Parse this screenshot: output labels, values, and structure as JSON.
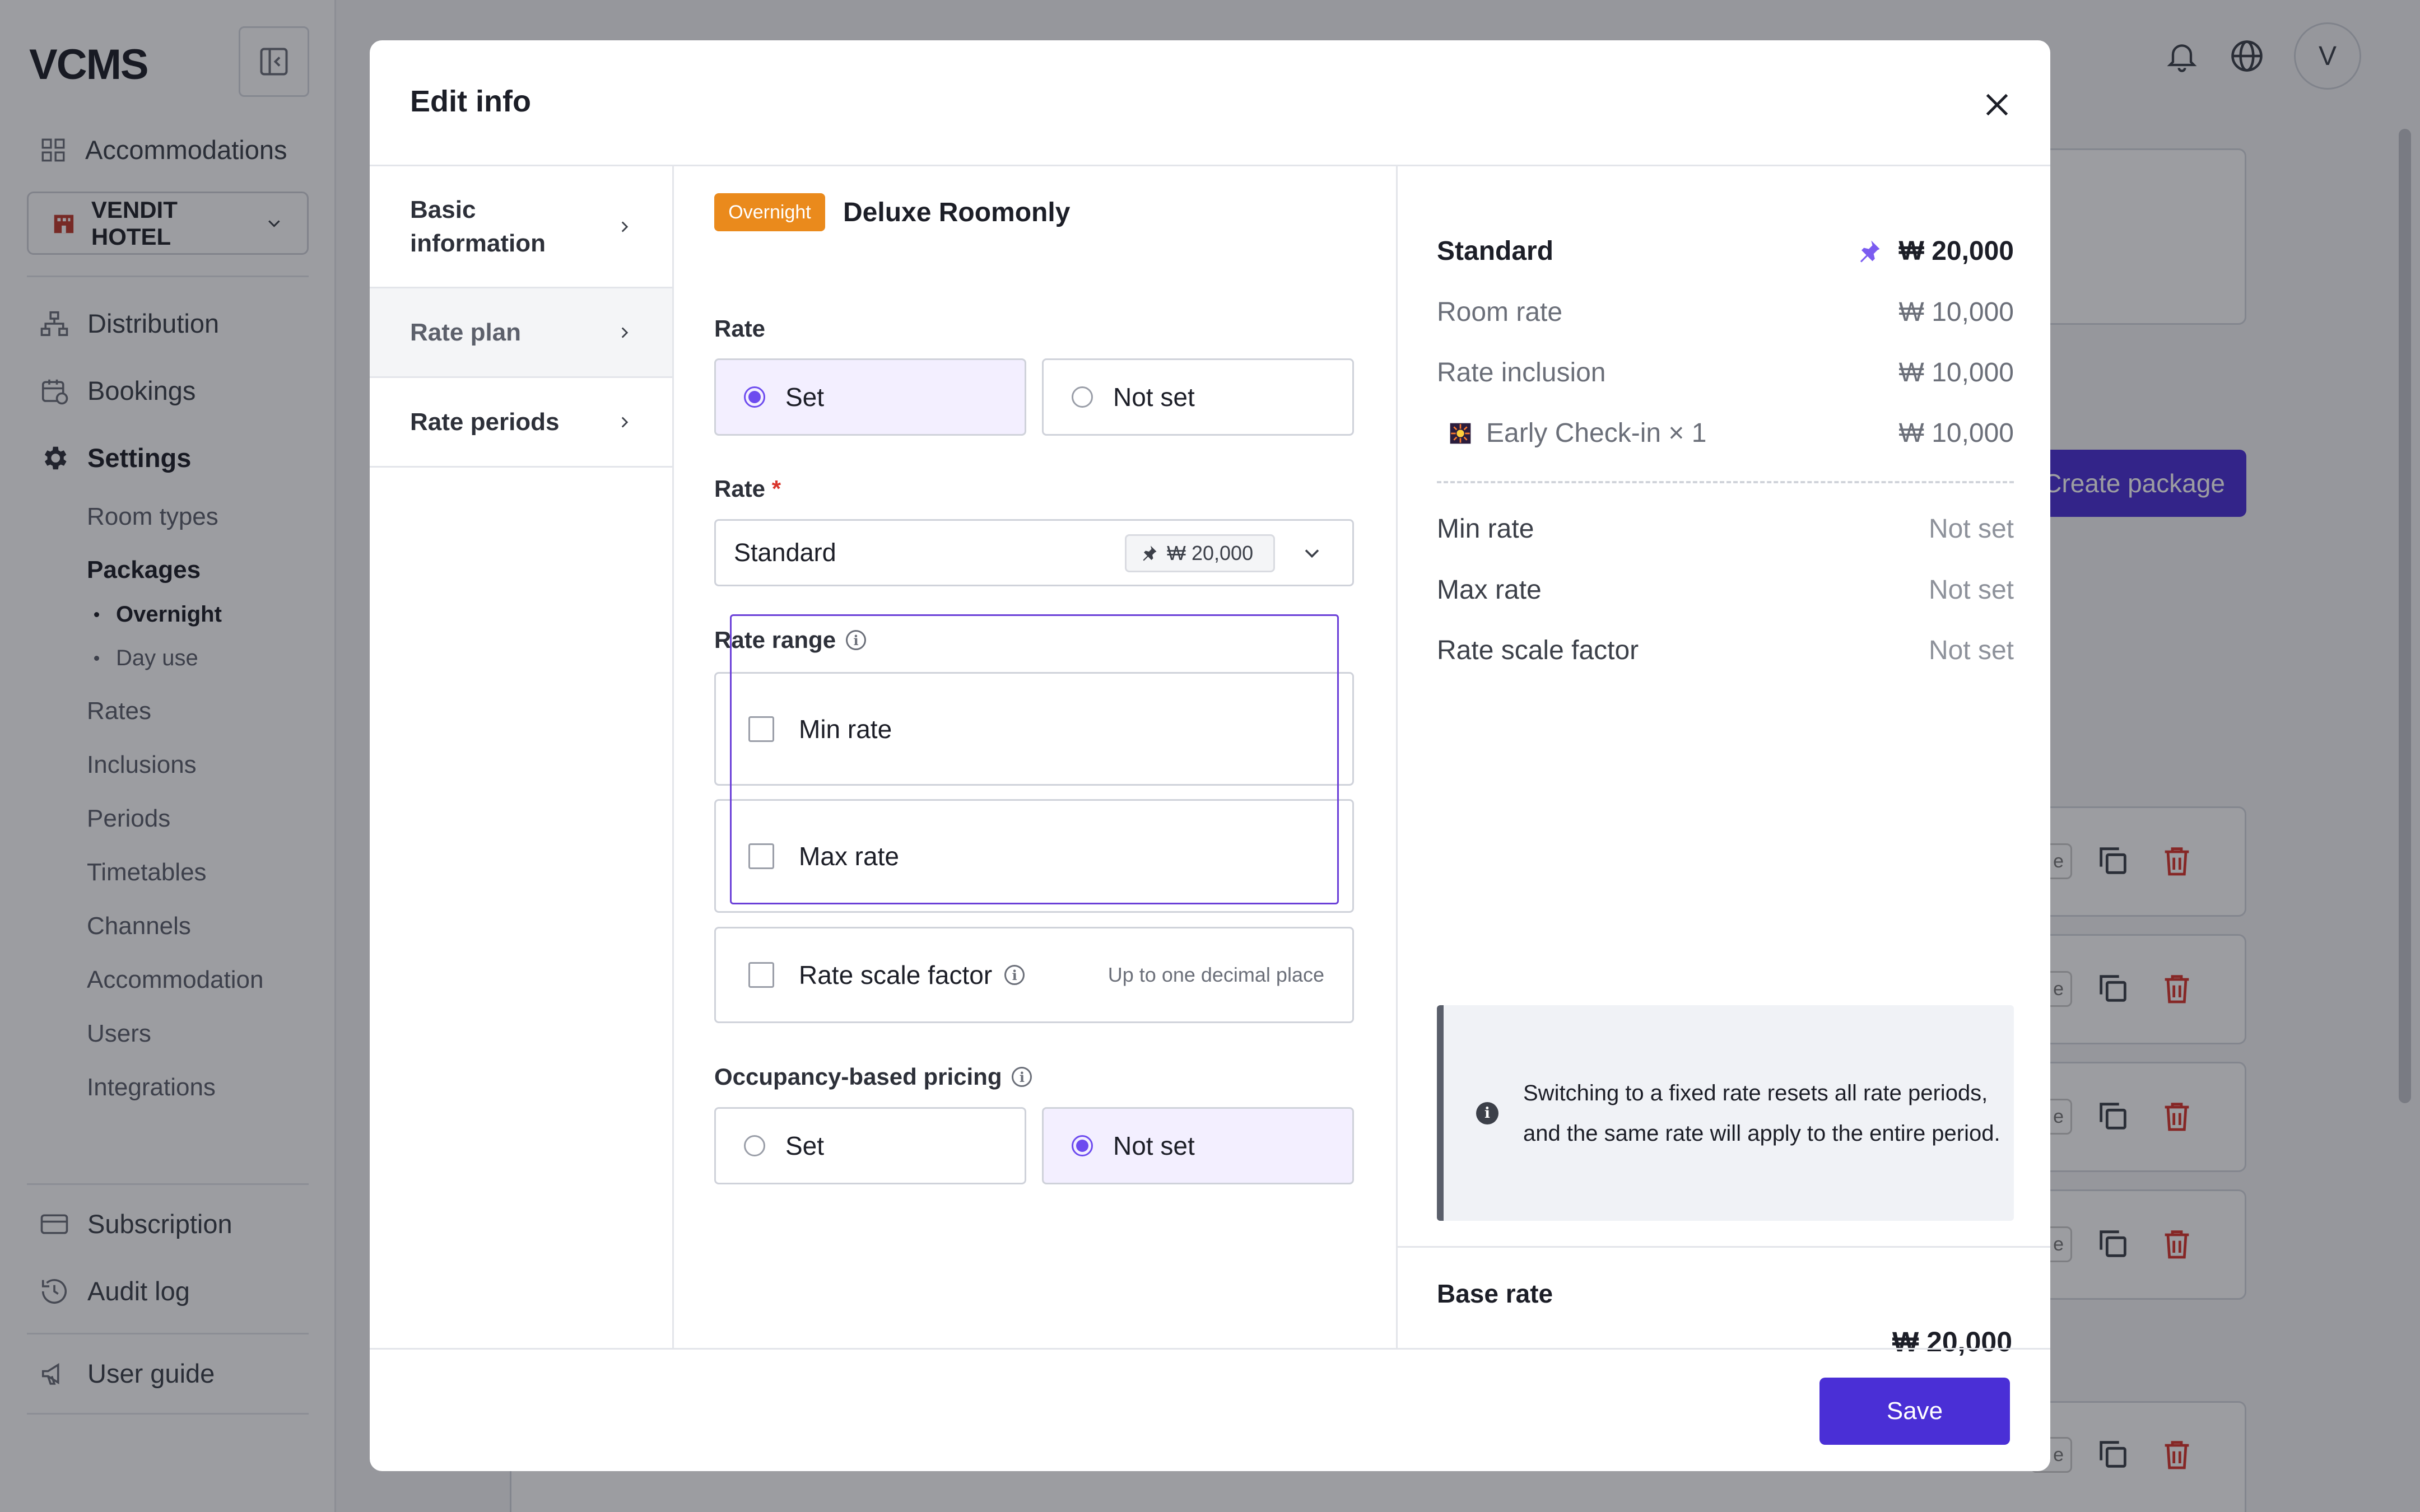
{
  "app": {
    "logo": "VCMS",
    "avatar_initial": "V"
  },
  "sidebar": {
    "accommodations_label": "Accommodations",
    "hotel_selector": "VENDIT HOTEL",
    "distribution": "Distribution",
    "bookings": "Bookings",
    "settings": "Settings",
    "settings_items": {
      "room_types": "Room types",
      "packages": "Packages",
      "overnight": "Overnight",
      "day_use": "Day use",
      "rates": "Rates",
      "inclusions": "Inclusions",
      "periods": "Periods",
      "timetables": "Timetables",
      "channels": "Channels",
      "accommodation": "Accommodation",
      "users": "Users",
      "integrations": "Integrations"
    },
    "subscription": "Subscription",
    "audit_log": "Audit log",
    "user_guide": "User guide"
  },
  "background": {
    "create_package": "Create package"
  },
  "modal": {
    "title": "Edit info",
    "tabs": [
      {
        "label": "Basic information"
      },
      {
        "label": "Rate plan"
      },
      {
        "label": "Rate periods"
      }
    ],
    "badge": "Overnight",
    "room_name": "Deluxe Roomonly",
    "rate_section_label": "Rate",
    "rate_options": {
      "set": "Set",
      "not_set": "Not set",
      "selected": "Set"
    },
    "rate_select_label": "Rate",
    "required_mark": "*",
    "rate_select_value": "Standard",
    "rate_select_chip": "₩ 20,000",
    "rate_range_label": "Rate range",
    "min_rate": "Min rate",
    "max_rate": "Max rate",
    "rate_scale_factor": "Rate scale factor",
    "rate_scale_hint": "Up to one decimal place",
    "occupancy_label": "Occupancy-based pricing",
    "occupancy_options": {
      "set": "Set",
      "not_set": "Not set",
      "selected": "Not set"
    },
    "summary": {
      "plan_name": "Standard",
      "plan_total": "₩ 20,000",
      "room_rate_label": "Room rate",
      "room_rate_value": "₩ 10,000",
      "rate_inclusion_label": "Rate inclusion",
      "rate_inclusion_value": "₩ 10,000",
      "inclusion_item_label": "Early Check-in × 1",
      "inclusion_item_value": "₩ 10,000",
      "min_rate_label": "Min rate",
      "min_rate_value": "Not set",
      "max_rate_label": "Max rate",
      "max_rate_value": "Not set",
      "scale_label": "Rate scale factor",
      "scale_value": "Not set",
      "notice_line1": "Switching to a fixed rate resets all rate periods,",
      "notice_line2": "and the same rate will apply to the entire period.",
      "base_rate_label": "Base rate",
      "base_rate_value": "₩ 20,000"
    },
    "save": "Save"
  },
  "colors": {
    "accent": "#4a2fd6",
    "radio_selected": "#6d4bef",
    "badge": "#ea8a1c",
    "delete": "#d9342b"
  }
}
